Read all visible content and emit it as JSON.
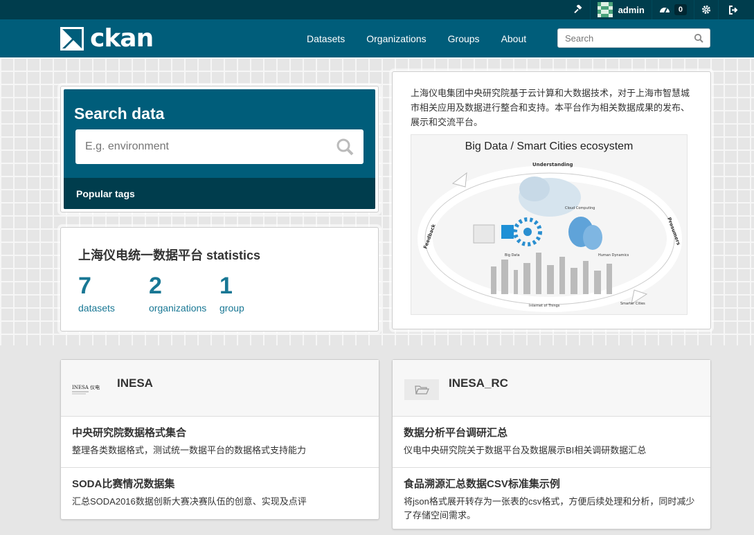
{
  "account": {
    "sysadmin_icon": "gavel-icon",
    "user": "admin",
    "dashboard_count": "0",
    "settings_icon": "gear-icon",
    "logout_icon": "sign-out-icon"
  },
  "header": {
    "logo_text": "ckan",
    "nav": [
      "Datasets",
      "Organizations",
      "Groups",
      "About"
    ],
    "search_placeholder": "Search"
  },
  "hero": {
    "search_title": "Search data",
    "search_placeholder": "E.g. environment",
    "popular_tags": "Popular tags"
  },
  "stats": {
    "title": "上海仪电统一数据平台 statistics",
    "items": [
      {
        "value": "7",
        "label": "datasets"
      },
      {
        "value": "2",
        "label": "organizations"
      },
      {
        "value": "1",
        "label": "group"
      }
    ]
  },
  "intro": {
    "text": "上海仪电集团中央研究院基于云计算和大数据技术，对于上海市智慧城市相关应用及数据进行整合和支持。本平台作为相关数据成果的发布、展示和交流平台。",
    "image": {
      "title": "Big Data / Smart Cities ecosystem",
      "labels": [
        "Understanding",
        "Feedback",
        "Prosumers",
        "Cloud Computing",
        "Big Data",
        "Human Dynamics",
        "Internet of Things",
        "Smarter Cities"
      ]
    }
  },
  "orgs": [
    {
      "name": "INESA",
      "logo_text": "INESA 仪电",
      "datasets": [
        {
          "title": "中央研究院数据格式集合",
          "desc": "整理各类数据格式，测试统一数据平台的数据格式支持能力"
        },
        {
          "title": "SODA比赛情况数据集",
          "desc": "汇总SODA2016数据创新大赛决赛队伍的创意、实现及点评"
        }
      ]
    },
    {
      "name": "INESA_RC",
      "datasets": [
        {
          "title": "数据分析平台调研汇总",
          "desc": "仪电中央研究院关于数据平台及数据展示BI相关调研数据汇总"
        },
        {
          "title": "食品溯源汇总数据CSV标准集示例",
          "desc": "将json格式展开转存为一张表的csv格式，方便后续处理和分析，同时减少了存储空间需求。"
        }
      ]
    }
  ],
  "colors": {
    "masthead": "#005d7a",
    "account_bar": "#003d4d",
    "accent": "#187794"
  }
}
